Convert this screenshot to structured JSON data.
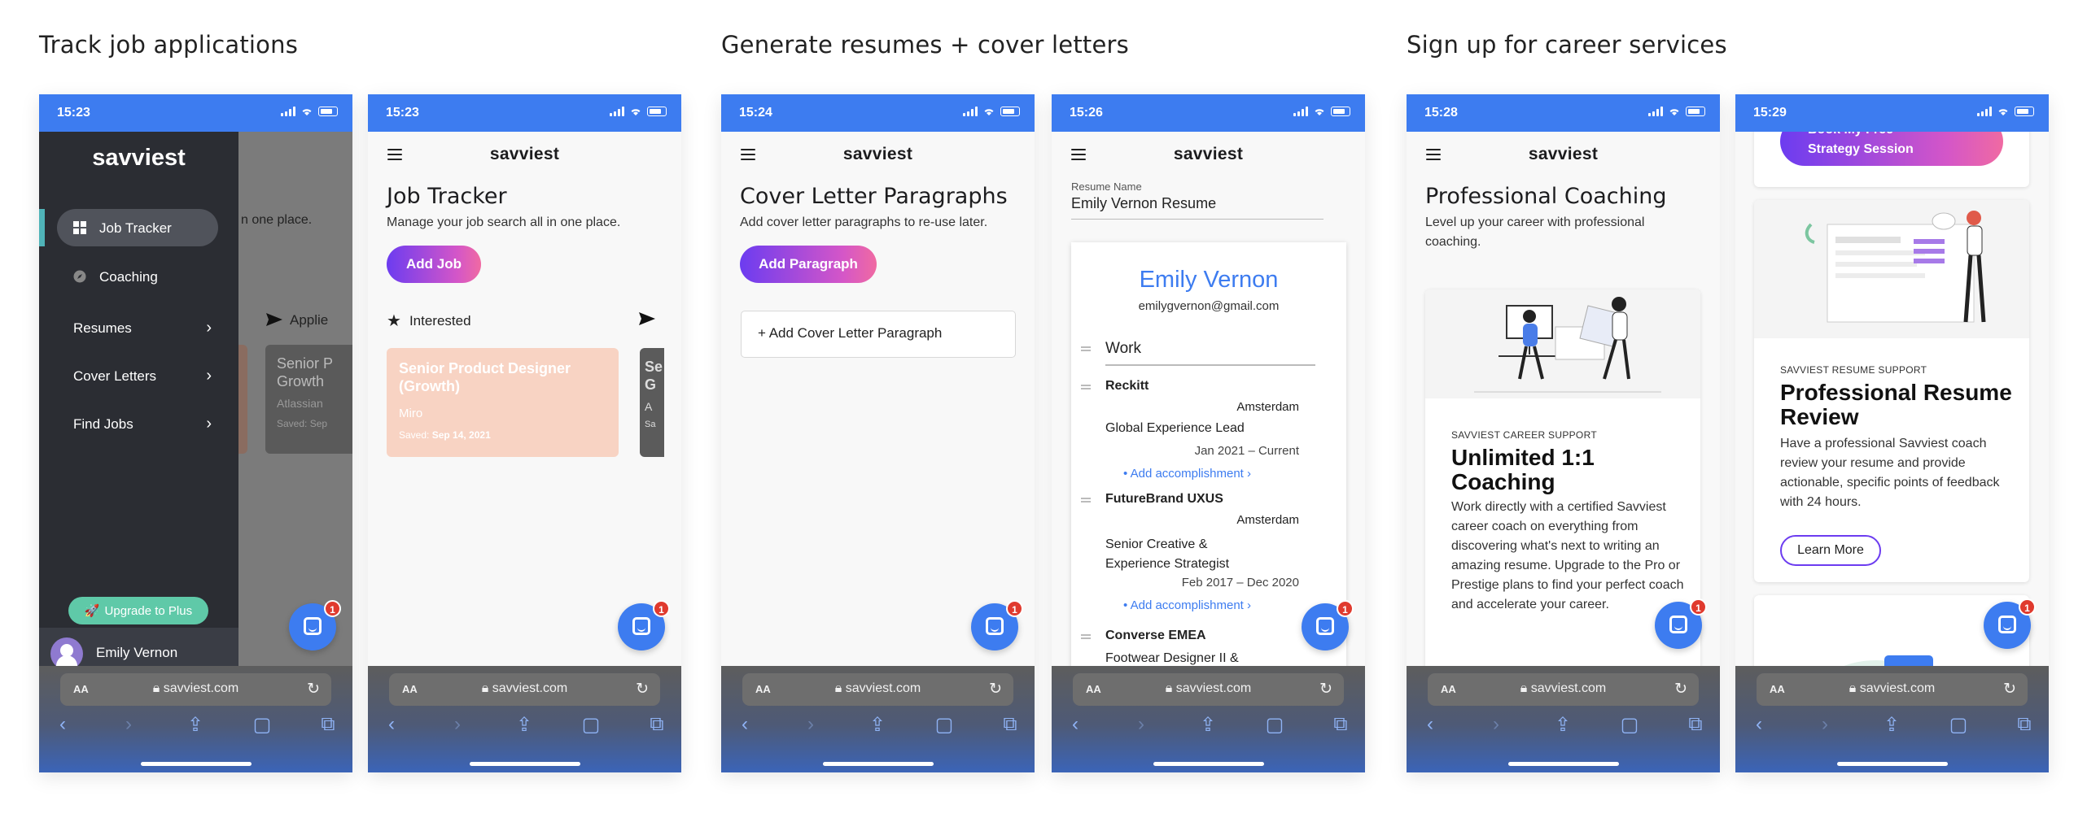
{
  "sections": [
    "Track job applications",
    "Generate resumes + cover letters",
    "Sign up for career services"
  ],
  "browser": {
    "aa_label": "AA",
    "url": "savviest.com",
    "reload_icon": "reload-icon",
    "toolbar_icons": [
      "back-icon",
      "forward-icon",
      "share-icon",
      "bookmarks-icon",
      "tabs-icon"
    ]
  },
  "app": {
    "logo": "savviest",
    "chat_badge": "1"
  },
  "colors": {
    "status_blue": "#3d7cf0",
    "sidebar_dark": "#2b2d33",
    "peach_card": "#f8d3c3",
    "teal_upgrade": "#5fc9a8"
  },
  "screens": {
    "menu": {
      "time": "15:23",
      "background_title_fragment": "n one place.",
      "background_tab_fragment": "Applie",
      "background_card_title": "Senior P Growth",
      "background_card_company": "Atlassian",
      "background_card_saved": "Saved: Sep",
      "items": [
        {
          "label": "Job Tracker",
          "icon": "grid-icon"
        },
        {
          "label": "Coaching",
          "icon": "compass-icon"
        },
        {
          "label": "Resumes",
          "icon": "chevron-right-icon"
        },
        {
          "label": "Cover Letters",
          "icon": "chevron-right-icon"
        },
        {
          "label": "Find Jobs",
          "icon": "chevron-right-icon"
        }
      ],
      "upgrade_label": "Upgrade to Plus",
      "user_name": "Emily Vernon"
    },
    "job_tracker": {
      "time": "15:23",
      "title": "Job Tracker",
      "subtitle": "Manage your job search all in one place.",
      "add_button": "Add Job",
      "column_label": "Interested",
      "card": {
        "title": "Senior Product Designer (Growth)",
        "company": "Miro",
        "saved_label": "Saved:",
        "saved_date": "Sep 14, 2021"
      },
      "peek_card": {
        "title": "Se G",
        "company": "A",
        "saved": "Sa"
      }
    },
    "cover_letter": {
      "time": "15:24",
      "title": "Cover Letter Paragraphs",
      "subtitle": "Add cover letter paragraphs to re-use later.",
      "add_button": "Add Paragraph",
      "add_row": "+ Add Cover Letter Paragraph"
    },
    "resume": {
      "time": "15:26",
      "field_label": "Resume Name",
      "field_value": "Emily Vernon Resume",
      "name": "Emily Vernon",
      "email": "emilygvernon@gmail.com",
      "section": "Work",
      "add_accomplishment": "Add accomplishment",
      "jobs": [
        {
          "company": "Reckitt",
          "location": "Amsterdam",
          "role": "Global Experience Lead",
          "dates": "Jan 2021 – Current"
        },
        {
          "company": "FutureBrand UXUS",
          "location": "Amsterdam",
          "role": "Senior Creative & Experience Strategist",
          "dates": "Feb 2017 – Dec 2020"
        },
        {
          "company": "Converse EMEA",
          "location": "",
          "role": "Footwear Designer II &",
          "dates": ""
        }
      ]
    },
    "coaching": {
      "time": "15:28",
      "title": "Professional Coaching",
      "subtitle": "Level up your career with professional coaching.",
      "eyebrow": "SAVVIEST CAREER SUPPORT",
      "card_title": "Unlimited 1:1 Coaching",
      "card_body": "Work directly with a certified Savviest career coach on everything from discovering what's next to writing an amazing resume. Upgrade to the Pro or Prestige plans to find your perfect coach and accelerate your career."
    },
    "resume_review": {
      "time": "15:29",
      "top_button": "Book My Free Strategy Session",
      "eyebrow": "SAVVIEST RESUME SUPPORT",
      "card_title": "Professional Resume Review",
      "card_body": "Have a professional Savviest coach review your resume and provide actionable, specific points of feedback with 24 hours.",
      "learn_more": "Learn More"
    }
  }
}
